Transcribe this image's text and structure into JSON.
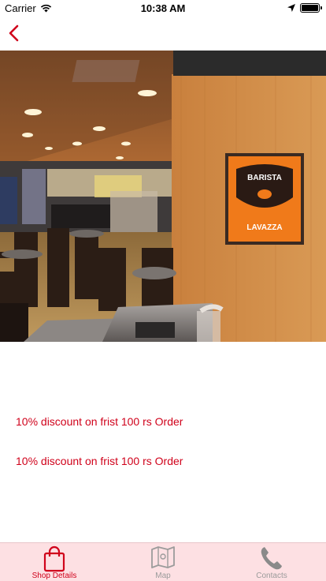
{
  "status_bar": {
    "carrier": "Carrier",
    "time": "10:38 AM"
  },
  "nav": {
    "back_icon": "chevron-left-icon",
    "accent_color": "#d0021b"
  },
  "hero": {
    "alt": "Barista Lavazza cafe interior",
    "sign_brand": "BARISTA",
    "sign_partner": "LAVAZZA"
  },
  "offers": [
    "10% discount on frist 100 rs Order",
    "10% discount on frist 100 rs Order"
  ],
  "tab_bar": {
    "background": "#fde0e3",
    "tabs": [
      {
        "label": "Shop Details",
        "icon": "shopping-bag-icon",
        "active": true
      },
      {
        "label": "Map",
        "icon": "map-icon",
        "active": false
      },
      {
        "label": "Contacts",
        "icon": "phone-icon",
        "active": false
      }
    ]
  }
}
